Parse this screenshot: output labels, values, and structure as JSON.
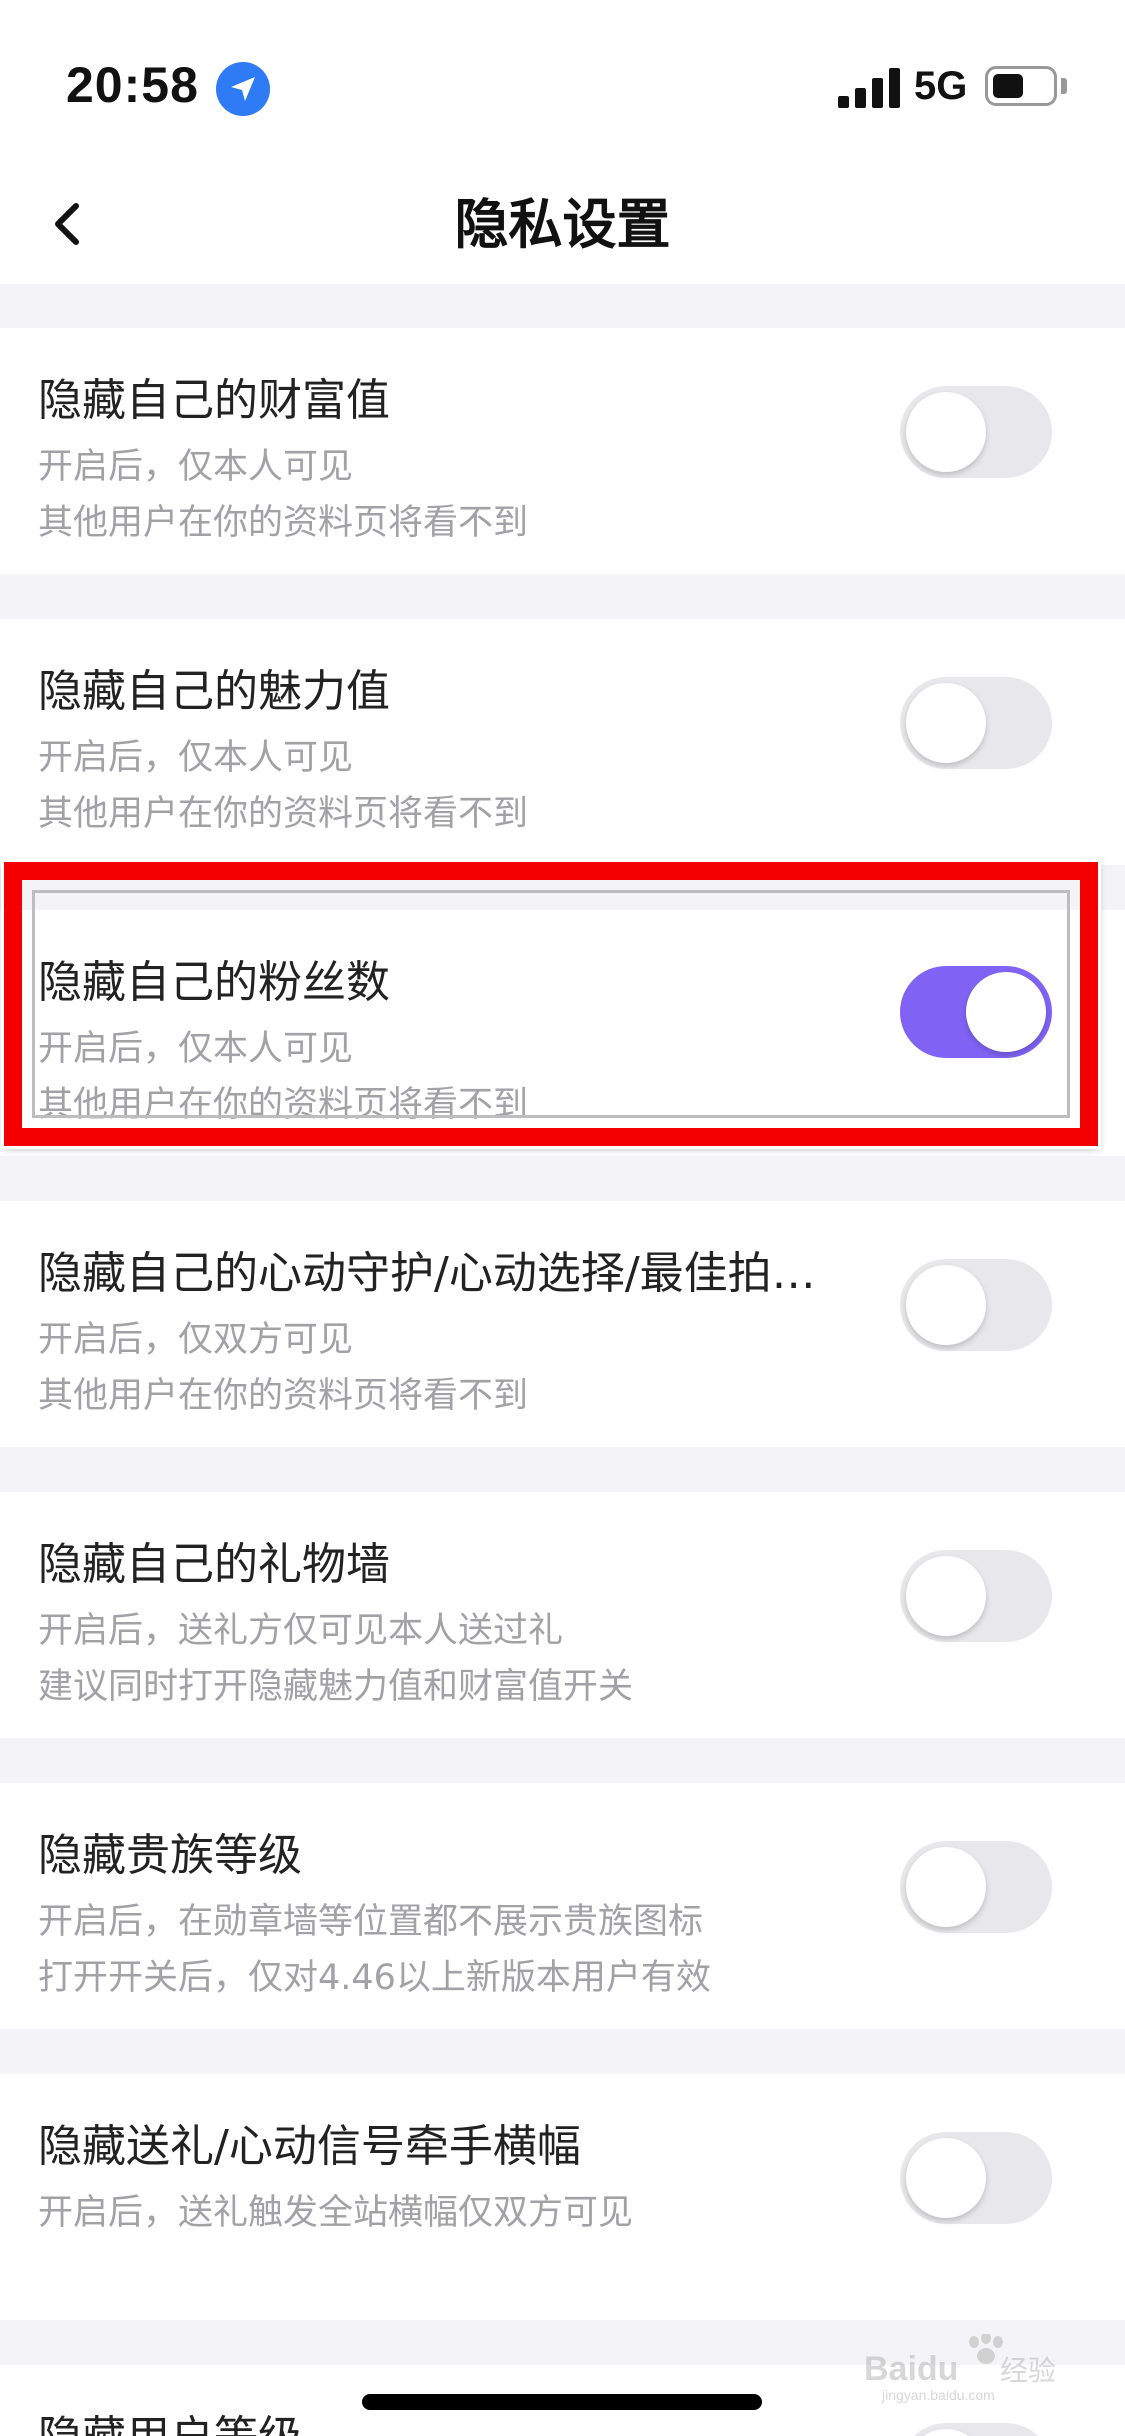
{
  "status_bar": {
    "time": "20:58",
    "network": "5G",
    "icons": [
      "location-arrow-icon",
      "signal-icon",
      "battery-icon"
    ]
  },
  "nav": {
    "title": "隐私设置",
    "back_icon": "chevron-left-icon"
  },
  "settings": [
    {
      "title": "隐藏自己的财富值",
      "desc": [
        "开启后，仅本人可见",
        "其他用户在你的资料页将看不到"
      ],
      "enabled": false
    },
    {
      "title": "隐藏自己的魅力值",
      "desc": [
        "开启后，仅本人可见",
        "其他用户在你的资料页将看不到"
      ],
      "enabled": false
    },
    {
      "title": "隐藏自己的粉丝数",
      "desc": [
        "开启后，仅本人可见",
        "其他用户在你的资料页将看不到"
      ],
      "enabled": true
    },
    {
      "title": "隐藏自己的心动守护/心动选择/最佳拍…",
      "desc": [
        "开启后，仅双方可见",
        "其他用户在你的资料页将看不到"
      ],
      "enabled": false
    },
    {
      "title": "隐藏自己的礼物墙",
      "desc": [
        "开启后，送礼方仅可见本人送过礼",
        "建议同时打开隐藏魅力值和财富值开关"
      ],
      "enabled": false
    },
    {
      "title": "隐藏贵族等级",
      "desc": [
        "开启后，在勋章墙等位置都不展示贵族图标",
        "打开开关后，仅对4.46以上新版本用户有效"
      ],
      "enabled": false
    },
    {
      "title": "隐藏送礼/心动信号牵手横幅",
      "desc": [
        "开启后，送礼触发全站横幅仅双方可见"
      ],
      "enabled": false
    },
    {
      "title": "隐藏用户等级",
      "desc": [],
      "enabled": false
    }
  ],
  "colors": {
    "toggle_on": "#8063f5",
    "toggle_off": "#e8e8ea",
    "highlight": "#f50000",
    "location": "#2f7bf5",
    "page_bg": "#f4f4f6"
  },
  "watermark": {
    "brand": "Baidu",
    "brand_cn": "经验",
    "url": "jingyan.baidu.com"
  }
}
